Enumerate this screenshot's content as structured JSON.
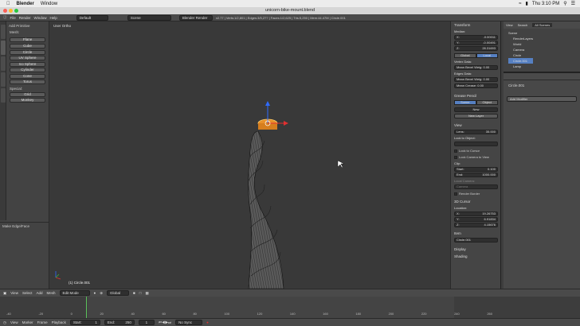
{
  "macbar": {
    "apple": "",
    "app": "Blender",
    "menu": [
      "Window"
    ],
    "clock": "Thu 3:10 PM"
  },
  "window": {
    "title": "unicorn-bike-mount.blend"
  },
  "infobar": {
    "menus": [
      "File",
      "Render",
      "Window",
      "Help"
    ],
    "layout": "Default",
    "scene": "Scene",
    "engine": "Blender Render",
    "stats": "v2.77 | Verts:1/2,801 | Edges:3/5,2?? | Faces:1/2,625 | Tris:5,250 | Mem:44.47M | Circle.001"
  },
  "toolshelf": {
    "add_primitive_label": "Add Primitive",
    "mesh_label": "Mesh:",
    "buttons": [
      "Plane",
      "Cube",
      "Circle",
      "UV Sphere",
      "Ico Sphere",
      "Cylinder",
      "Cone",
      "Torus"
    ],
    "special_label": "Special:",
    "special_buttons": [
      "Grid",
      "Monkey"
    ],
    "last_op": "Make Edge/Face"
  },
  "viewport": {
    "view_label": "User Ortho",
    "object_label": "(1) Circle.001"
  },
  "nregion": {
    "transform": "Transform",
    "median": "Median:",
    "x_label": "X:",
    "x_val": "-0.00011",
    "y_label": "Y:",
    "y_val": "-0.00491",
    "z_label": "Z:",
    "z_val": "28.31693",
    "global": "Global",
    "local": "Local",
    "vertex_data": "Vertex Data:",
    "mean_bevel": "Mean Bevel Weig: 0.00",
    "edges_data": "Edges Data:",
    "mean_bevel2": "Mean Bevel Weig: 0.00",
    "mean_crease": "Mean Crease: 0.00",
    "grease_pencil": "Grease Pencil",
    "scene_btn": "Scene",
    "object_btn": "Object",
    "new_btn": "New",
    "new_layer": "New Layer",
    "view_sec": "View",
    "lens": "Lens:",
    "lens_val": "35.000",
    "lock_to_object": "Lock to Object:",
    "lock_to_cursor": "Lock to Cursor",
    "lock_camera": "Lock Camera to View",
    "clip": "Clip:",
    "start": "Start:",
    "start_val": "0.100",
    "end": "End:",
    "end_val": "1000.000",
    "local_camera": "Local Camera:",
    "camera": "Camera",
    "render_border": "Render Border",
    "cursor3d": "3D Cursor",
    "location": "Location:",
    "cx_label": "X:",
    "cx_val": "19.26753",
    "cy_label": "Y:",
    "cy_val": "6.91834",
    "cz_label": "Z:",
    "cz_val": "4.15676",
    "item": "Item",
    "item_name": "Circle.001",
    "display": "Display",
    "shading": "Shading"
  },
  "outliner": {
    "view": "View",
    "search": "Search",
    "all_scenes": "All Scenes",
    "items": [
      "Scene",
      "RenderLayers",
      "World",
      "Camera",
      "Circle",
      "Circle.001",
      "Lamp"
    ]
  },
  "props": {
    "object_name": "Circle.001",
    "add_modifier": "Add Modifier"
  },
  "viewhdr": {
    "items": [
      "View",
      "Select",
      "Add",
      "Mesh"
    ],
    "mode": "Edit Mode",
    "pivot": "Global"
  },
  "timeline": {
    "ticks": [
      "-40",
      "-20",
      "0",
      "20",
      "40",
      "60",
      "80",
      "100",
      "120",
      "140",
      "160",
      "180",
      "200",
      "220",
      "240",
      "260"
    ]
  },
  "tlhdr": {
    "items": [
      "View",
      "Marker",
      "Frame",
      "Playback"
    ],
    "start": "Start:",
    "start_val": "1",
    "end": "End:",
    "end_val": "250",
    "current": "1",
    "sync": "No Sync"
  }
}
